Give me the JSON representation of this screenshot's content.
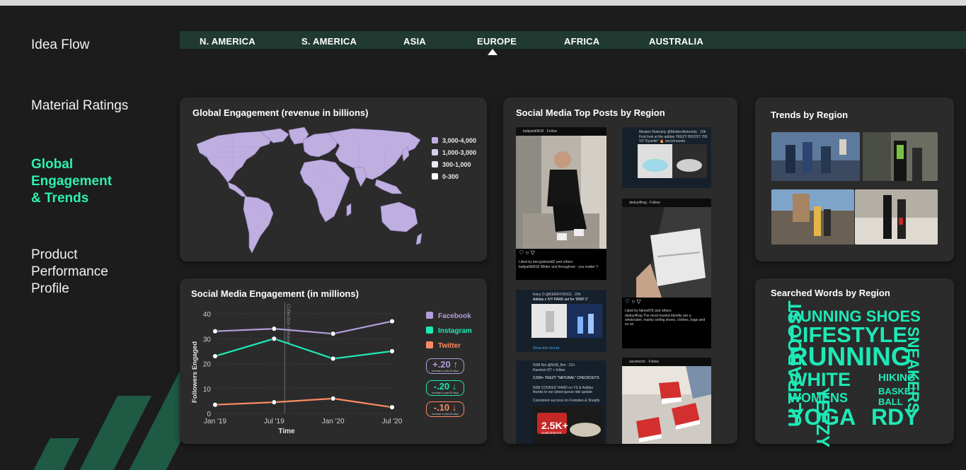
{
  "sidebar": {
    "items": [
      {
        "label": "Idea Flow"
      },
      {
        "label": "Material Ratings"
      },
      {
        "label": "Global Engagement & Trends"
      },
      {
        "label": "Product Performance Profile"
      }
    ],
    "active_index": 2
  },
  "regions": [
    "N. AMERICA",
    "S. AMERICA",
    "ASIA",
    "EUROPE",
    "AFRICA",
    "AUSTRALIA"
  ],
  "selected_region": "EUROPE",
  "colors": {
    "accent": "#2ef0b0",
    "map": "#bfaee0",
    "facebook": "#b39ddb",
    "instagram": "#1de9b6",
    "twitter": "#ff8a65",
    "region_bar": "#213a31"
  },
  "global_engagement": {
    "title": "Global Engagement (revenue in billions)",
    "legend": [
      {
        "label": "3,000-4,000",
        "color": "#bfaee0"
      },
      {
        "label": "1,000-3,000",
        "color": "#d8ccec"
      },
      {
        "label": "300-1,000",
        "color": "#ece6f6"
      },
      {
        "label": "0-300",
        "color": "#ffffff"
      }
    ]
  },
  "social_engagement": {
    "title": "Social Media Engagement (in millions)",
    "annotation": "Collection release",
    "changes": [
      {
        "value": "+.20",
        "arrow": "↑",
        "sub": "increase in past 30 days",
        "color": "#b39ddb"
      },
      {
        "value": "-.20",
        "arrow": "↓",
        "sub": "increase in past 30 days",
        "color": "#1de9b6"
      },
      {
        "value": "-.10",
        "arrow": "↓",
        "sub": "increase in past 30 days",
        "color": "#ff8a65"
      }
    ]
  },
  "chart_data": {
    "type": "line",
    "title": "Social Media Engagement (in millions)",
    "xlabel": "Time",
    "ylabel": "Followers Engaged",
    "x": [
      "Jan '19",
      "Jul '19",
      "Jan '20",
      "Jul '20"
    ],
    "ylim": [
      0,
      40
    ],
    "yticks": [
      0,
      10,
      20,
      30,
      40
    ],
    "grid": true,
    "legend_position": "right",
    "series": [
      {
        "name": "Facebook",
        "values": [
          33,
          34,
          32,
          37
        ],
        "color": "#b39ddb"
      },
      {
        "name": "Instagram",
        "values": [
          23,
          30,
          22,
          25
        ],
        "color": "#1de9b6"
      },
      {
        "name": "Twitter",
        "values": [
          3.5,
          4.5,
          6,
          2.5
        ],
        "color": "#ff8a65"
      }
    ]
  },
  "top_posts": {
    "title": "Social Media Top Posts by Region",
    "posts": [
      {
        "header": "ballpaliit0818 · Follow",
        "caption": "Liked by kerrypdowdd2 and others",
        "caption2": "ballpaliit0818 Wilder and throughout - you matter !!"
      },
      {
        "header": "Modern Notoriety @ModernNotoriety · 10h",
        "caption": "First look at the adidas YEEZY BOOST 700 V3 \"Kyanite\" 🔥 ow.ly/zvaxda"
      },
      {
        "header": "dedsy4frag · Follow",
        "caption": "Liked by falmo878 and others",
        "caption2": "dedsy4frag The most trusted identity are a wholesaler, mainly selling shoes, clothes, bags and so on"
      },
      {
        "header": "Keiry O @KERRYONCE · 20h",
        "caption": "Adidas x IVY PARK set for 'DRIP 2'",
        "caption2": "Show this thread"
      },
      {
        "header": "NSB Bot @NSB_Bot · 21h",
        "caption": "Random RT + follow",
        "caption2": "2,500+ YEEZY \"NATURAL\" CHECKOUTS",
        "caption3": "NSB COOKED HARD on YS & Adidas thanks to our latest queue ride update",
        "caption4": "Consistent success on Footsites & Shopify",
        "badge": "2.5K+",
        "badge_sub": "CHECKOUTS"
      },
      {
        "header": "sarahwchr · Follow"
      }
    ]
  },
  "trends": {
    "title": "Trends by Region"
  },
  "searched_words": {
    "title": "Searched Words by Region",
    "words": [
      "RUNNING SHOES",
      "LIFESTYLE",
      "RUNNING",
      "WHITE",
      "WOMENS",
      "YOGA",
      "YEEZY",
      "HIKING",
      "BASKET",
      "BALL",
      "RDY",
      "ULTRABOOST",
      "SNEAKERS"
    ]
  }
}
